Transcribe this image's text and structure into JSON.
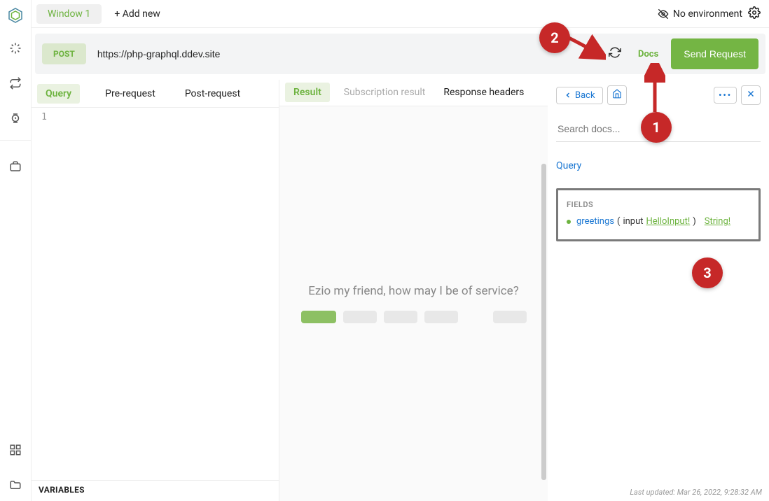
{
  "header": {
    "window_tab": "Window 1",
    "add_new": "+ Add new",
    "no_env": "No environment"
  },
  "request": {
    "method": "POST",
    "url": "https://php-graphql.ddev.site",
    "docs": "Docs",
    "send": "Send Request"
  },
  "query_tabs": {
    "query": "Query",
    "pre": "Pre-request",
    "post": "Post-request"
  },
  "editor": {
    "line1": "1",
    "variables": "VARIABLES"
  },
  "result_tabs": {
    "result": "Result",
    "subscription": "Subscription result",
    "headers": "Response headers"
  },
  "placeholder": {
    "text": "Ezio my friend, how may I be of service?"
  },
  "docs": {
    "back": "Back",
    "search_placeholder": "Search docs...",
    "query_root": "Query",
    "fields_label": "FIELDS",
    "field": {
      "name": "greetings",
      "arg_name": "input",
      "arg_type": "HelloInput!",
      "return_type": "String!"
    },
    "last_updated": "Last updated: Mar 26, 2022, 9:28:32 AM"
  },
  "annotations": {
    "a1": "1",
    "a2": "2",
    "a3": "3"
  }
}
